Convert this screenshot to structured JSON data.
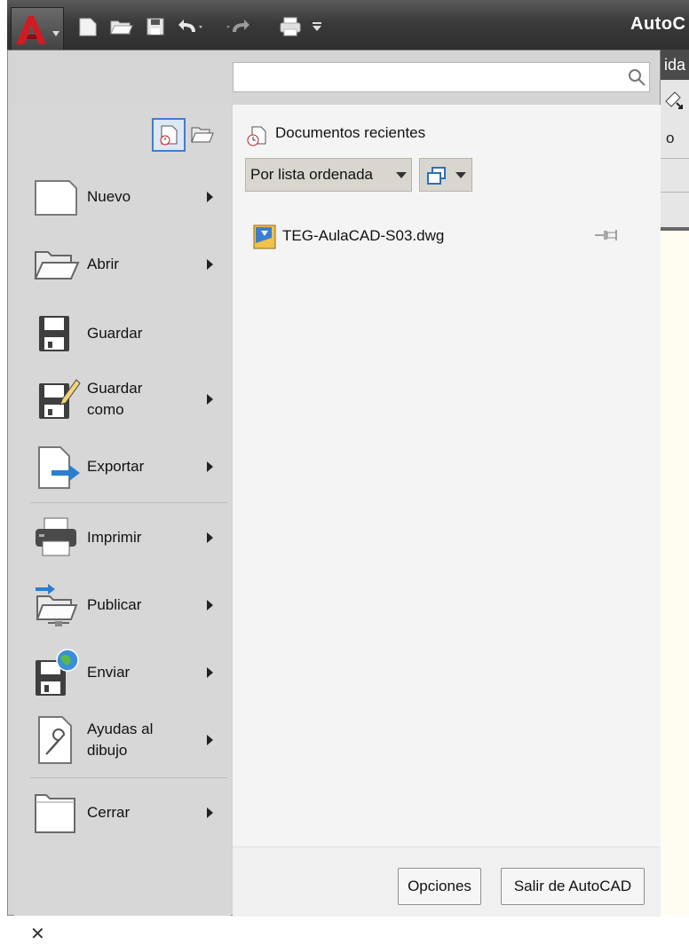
{
  "window": {
    "app_name": "AutoC"
  },
  "background_app": {
    "tab_fragment": "ida",
    "row_fragment": "o"
  },
  "search": {
    "placeholder": "",
    "value": ""
  },
  "menu": {
    "items": [
      {
        "label": "Nuevo",
        "icon": "new-document-icon",
        "submenu": true
      },
      {
        "label": "Abrir",
        "icon": "open-folder-icon",
        "submenu": true
      },
      {
        "label": "Guardar",
        "icon": "save-disk-icon",
        "submenu": false
      },
      {
        "label": "Guardar\ncomo",
        "icon": "save-as-icon",
        "submenu": true
      },
      {
        "label": "Exportar",
        "icon": "export-icon",
        "submenu": true
      },
      {
        "label": "Imprimir",
        "icon": "printer-icon",
        "submenu": true
      },
      {
        "label": "Publicar",
        "icon": "publish-icon",
        "submenu": true
      },
      {
        "label": "Enviar",
        "icon": "send-icon",
        "submenu": true
      },
      {
        "label": "Ayudas al\ndibujo",
        "icon": "drawing-utilities-icon",
        "submenu": true
      },
      {
        "label": "Cerrar",
        "icon": "close-folder-icon",
        "submenu": true
      }
    ]
  },
  "recent": {
    "title": "Documentos recientes",
    "sort_label": "Por lista ordenada",
    "files": [
      {
        "name": "TEG-AulaCAD-S03.dwg",
        "pinned": false
      }
    ]
  },
  "footer": {
    "options_label": "Opciones",
    "exit_label": "Salir de AutoCAD"
  },
  "status": {
    "close_glyph": "✕"
  },
  "colors": {
    "title_bar": "#3a3a3a",
    "panel": "#d7d7d7",
    "content": "#f4f4f4",
    "accent_blue": "#2a7fd0",
    "logo_red": "#c8161d"
  }
}
